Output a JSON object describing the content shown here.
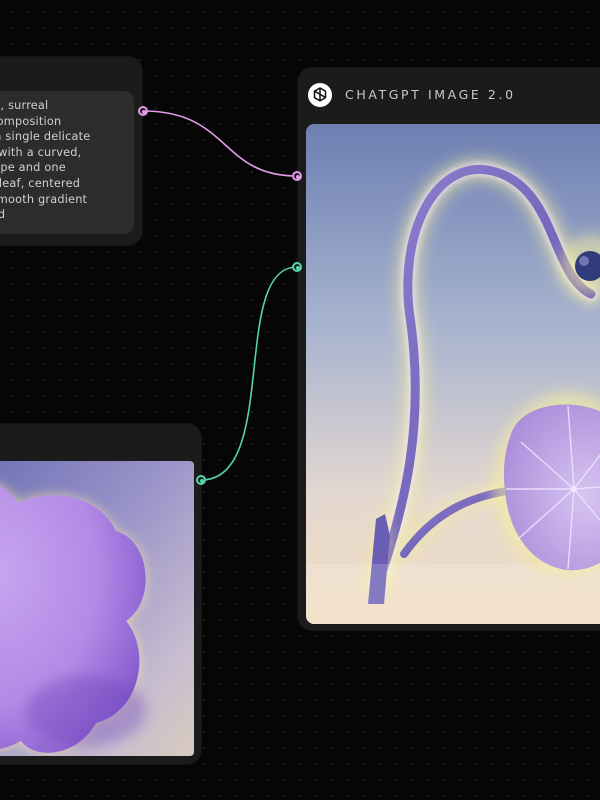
{
  "canvas": {
    "background": "#060606",
    "dot_color": "#1f1f1f"
  },
  "prompt_node": {
    "text_lines": [
      "...alist, surreal",
      "...al composition",
      "...ng a single delicate",
      "...em with a curved,",
      "... shape and one",
      "...ent leaf, centered",
      "... a smooth gradient",
      "...ound"
    ],
    "text": "alist, surreal\nal composition\nng a single delicate\nem with a curved,\n shape and one\nent leaf, centered\n a smooth gradient\nound"
  },
  "generator_node": {
    "title": "CHATGPT IMAGE 2.0",
    "logo_icon": "openai-logo-icon",
    "image_subject": "glowing purple curved stem with round bud and single round leaf on gradient background"
  },
  "reference_node": {
    "image_subject": "purple glowing cloud shape on gradient background"
  },
  "connections": [
    {
      "from": "prompt-node-output",
      "to": "generator-prompt-input",
      "color": "#e39ae8"
    },
    {
      "from": "reference-node-output",
      "to": "generator-image-input",
      "color": "#55d5a8"
    }
  ],
  "colors": {
    "node_bg": "#1b1b1b",
    "prompt_box_bg": "#2c2c2c",
    "text_primary": "#d0d0d0",
    "title_text": "#c9c9c9",
    "wire_prompt": "#e39ae8",
    "wire_image": "#55d5a8"
  }
}
